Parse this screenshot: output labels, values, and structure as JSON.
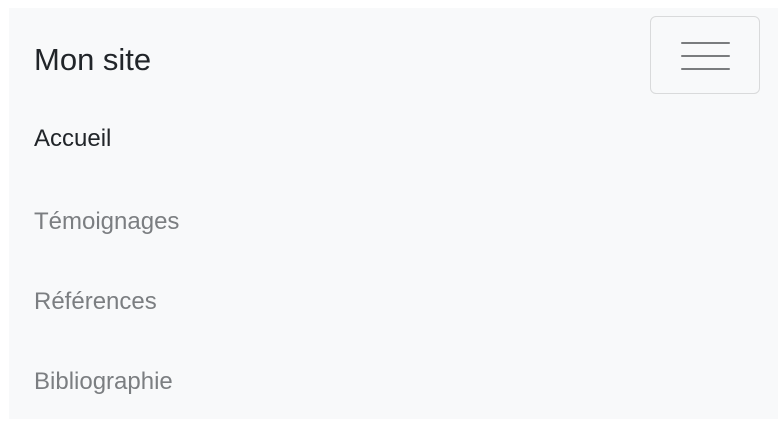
{
  "navbar": {
    "brand": "Mon site",
    "toggler": {
      "icon": "hamburger-menu-icon"
    },
    "links": [
      {
        "label": "Accueil",
        "active": true
      },
      {
        "label": "Témoignages",
        "active": false
      },
      {
        "label": "Références",
        "active": false
      },
      {
        "label": "Bibliographie",
        "active": false
      }
    ]
  },
  "colors": {
    "navbar_background": "#f8f9fa",
    "active_link": "#212529",
    "inactive_link": "#7b7e81",
    "toggler_border": "#d9dadb"
  }
}
